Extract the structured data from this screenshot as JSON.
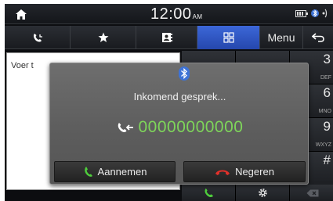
{
  "status": {
    "time": "12:00",
    "ampm": "AM"
  },
  "tabs": {
    "menu_label": "Menu"
  },
  "number_input": {
    "placeholder": "Voer t"
  },
  "keypad": {
    "keys": [
      {
        "digit": "",
        "letters": ""
      },
      {
        "digit": "",
        "letters": ""
      },
      {
        "digit": "3",
        "letters": "DEF"
      },
      {
        "digit": "",
        "letters": ""
      },
      {
        "digit": "",
        "letters": ""
      },
      {
        "digit": "6",
        "letters": "MNO"
      },
      {
        "digit": "",
        "letters": ""
      },
      {
        "digit": "",
        "letters": ""
      },
      {
        "digit": "9",
        "letters": "WXYZ"
      },
      {
        "digit": "",
        "letters": ""
      },
      {
        "digit": "",
        "letters": ""
      },
      {
        "digit": "#",
        "letters": ""
      }
    ]
  },
  "popup": {
    "title": "Inkomend gesprek...",
    "number": "00000000000",
    "accept_label": "Aannemen",
    "reject_label": "Negeren"
  },
  "colors": {
    "accent_blue": "#2f57c8",
    "number_green": "#7ed55a",
    "accept_green": "#4fcf3c",
    "reject_red": "#e0302a"
  }
}
